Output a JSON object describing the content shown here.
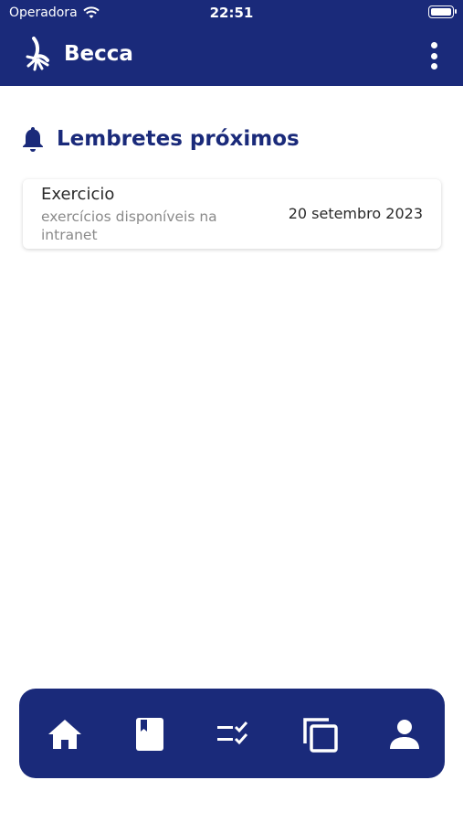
{
  "status_bar": {
    "carrier": "Operadora",
    "time": "22:51"
  },
  "app_bar": {
    "title": "Becca"
  },
  "section": {
    "heading": "Lembretes próximos"
  },
  "reminders": [
    {
      "title": "Exercicio",
      "description": "exercícios disponíveis na intranet",
      "date": "20 setembro 2023"
    }
  ],
  "bottom_nav": {
    "items": [
      {
        "icon": "home-icon"
      },
      {
        "icon": "book-icon"
      },
      {
        "icon": "checklist-icon"
      },
      {
        "icon": "copy-icon"
      },
      {
        "icon": "person-icon"
      }
    ]
  },
  "colors": {
    "primary": "#1a2a7a",
    "background": "#ffffff",
    "muted_text": "#8a8a8a"
  }
}
